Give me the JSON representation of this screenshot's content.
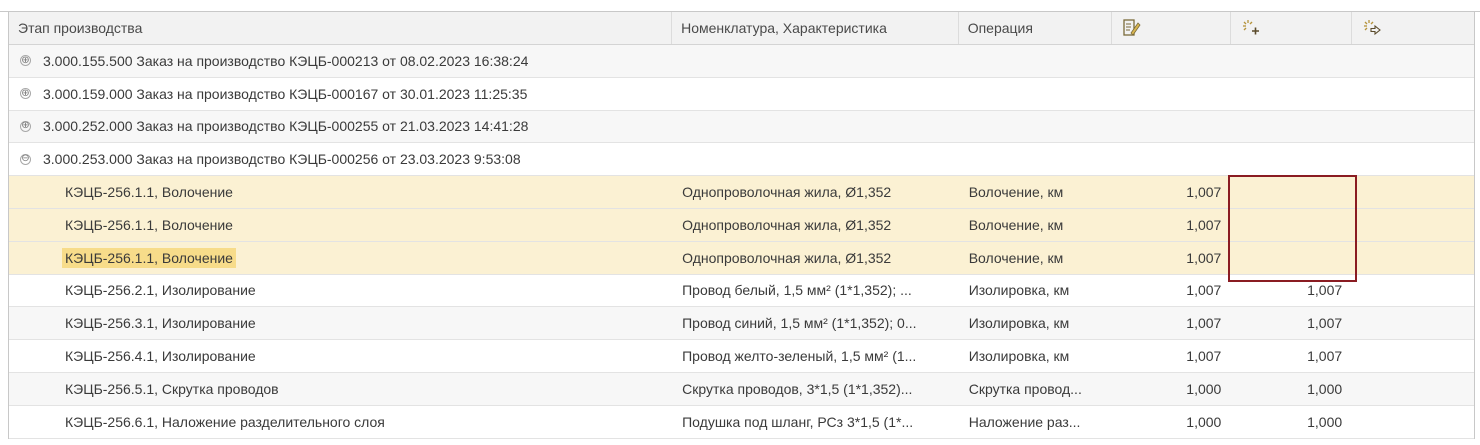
{
  "columns": {
    "stage": "Этап производства",
    "nomenclature": "Номенклатура, Характеристика",
    "operation": "Операция",
    "icon_a": "edit-doc-icon",
    "icon_b": "sparkle-add-icon",
    "icon_c": "sparkle-arrow-icon"
  },
  "rows": [
    {
      "type": "group",
      "toggle": "⊕",
      "stage": "3.000.155.500 Заказ на производство КЭЦБ-000213 от 08.02.2023 16:38:24"
    },
    {
      "type": "group",
      "toggle": "⊕",
      "stage": "3.000.159.000 Заказ на производство КЭЦБ-000167 от 30.01.2023 11:25:35"
    },
    {
      "type": "group",
      "toggle": "⊕",
      "stage": "3.000.252.000 Заказ на производство КЭЦБ-000255 от 21.03.2023 14:41:28"
    },
    {
      "type": "group",
      "toggle": "⊖",
      "stage": "3.000.253.000 Заказ на производство КЭЦБ-000256 от 23.03.2023 9:53:08"
    },
    {
      "type": "item",
      "stage": "КЭЦБ-256.1.1, Волочение",
      "nom": "Однопроволочная жила, Ø1,352",
      "op": "Волочение, км",
      "v1": "1,007",
      "v2": "",
      "v3": ""
    },
    {
      "type": "item",
      "stage": "КЭЦБ-256.1.1, Волочение",
      "nom": "Однопроволочная жила, Ø1,352",
      "op": "Волочение, км",
      "v1": "1,007",
      "v2": "",
      "v3": ""
    },
    {
      "type": "item",
      "stage": "КЭЦБ-256.1.1, Волочение",
      "nom": "Однопроволочная жила, Ø1,352",
      "op": "Волочение, км",
      "v1": "1,007",
      "v2": "",
      "v3": ""
    },
    {
      "type": "item",
      "stage": "КЭЦБ-256.2.1, Изолирование",
      "nom": "Провод белый, 1,5 мм² (1*1,352); ...",
      "op": "Изолировка, км",
      "v1": "1,007",
      "v2": "1,007",
      "v3": ""
    },
    {
      "type": "item",
      "stage": "КЭЦБ-256.3.1, Изолирование",
      "nom": "Провод синий, 1,5 мм² (1*1,352); 0...",
      "op": "Изолировка, км",
      "v1": "1,007",
      "v2": "1,007",
      "v3": ""
    },
    {
      "type": "item",
      "stage": "КЭЦБ-256.4.1, Изолирование",
      "nom": "Провод желто-зеленый, 1,5 мм² (1...",
      "op": "Изолировка, км",
      "v1": "1,007",
      "v2": "1,007",
      "v3": ""
    },
    {
      "type": "item",
      "stage": "КЭЦБ-256.5.1, Скрутка проводов",
      "nom": "Скрутка проводов, 3*1,5 (1*1,352)...",
      "op": "Скрутка провод...",
      "v1": "1,000",
      "v2": "1,000",
      "v3": ""
    },
    {
      "type": "item",
      "stage": "КЭЦБ-256.6.1, Наложение разделительного слоя",
      "nom": "Подушка под шланг, РСз 3*1,5 (1*...",
      "op": "Наложение раз...",
      "v1": "1,000",
      "v2": "1,000",
      "v3": ""
    }
  ],
  "colors": {
    "selected_row": "#fbf1d3",
    "highlight_cell": "#f7dc8a",
    "red_frame": "#8a1c22",
    "icon_gold": "#b5933a"
  }
}
